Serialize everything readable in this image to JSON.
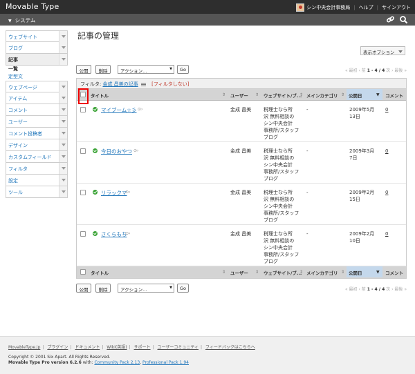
{
  "app": {
    "brand": "Movable Type"
  },
  "header": {
    "site_name": "シン中央会計事務局",
    "help": "ヘルプ",
    "signout": "サインアウト"
  },
  "scope": {
    "name": "システム"
  },
  "sidebar": {
    "items": [
      {
        "label": "ウェブサイト"
      },
      {
        "label": "ブログ"
      },
      {
        "label": "記事"
      },
      {
        "label": "ウェブページ"
      },
      {
        "label": "アイテム"
      },
      {
        "label": "コメント"
      },
      {
        "label": "ユーザー"
      },
      {
        "label": "コメント投稿者"
      },
      {
        "label": "デザイン"
      },
      {
        "label": "カスタムフィールド"
      },
      {
        "label": "フィルタ"
      },
      {
        "label": "設定"
      },
      {
        "label": "ツール"
      }
    ],
    "sub": {
      "list": "一覧",
      "template": "定型文"
    }
  },
  "main": {
    "title": "記事の管理",
    "display_options": "表示オプション"
  },
  "actions": {
    "publish": "公開",
    "delete": "削除",
    "select": "アクション...",
    "go": "Go",
    "pager_prev": "« 最初",
    "pager_prev2": "‹ 前",
    "pager_range": "1 - 4 / 4",
    "pager_next": "次 ›",
    "pager_last": "最後 »"
  },
  "filter": {
    "label": "フィルタ:",
    "value": "金成 昌美の記事",
    "clear": "[フィルタしない]"
  },
  "table": {
    "headers": {
      "title": "タイトル",
      "user": "ユーザー",
      "website": "ウェブサイト/ブ...",
      "category": "メインカテゴリ",
      "date": "公開日",
      "comments": "コメント"
    },
    "rows": [
      {
        "title": "マイブーム☆彡",
        "user": "金成 昌美",
        "blog": "税理士なら所沢 無料相談のシン中央会計事務所/スタッフブログ",
        "blog1": "税理士なら所",
        "blog2": "沢 無料相談の",
        "blog3": "シン中央会計",
        "blog4": "事務所/スタッフ",
        "blog5": "ブログ",
        "category": "-",
        "date1": "2009年5月",
        "date2": "13日",
        "comments": "0"
      },
      {
        "title": "今日のおやつ",
        "user": "金成 昌美",
        "blog1": "税理士なら所",
        "blog2": "沢 無料相談の",
        "blog3": "シン中央会計",
        "blog4": "事務所/スタッフ",
        "blog5": "ブログ",
        "category": "-",
        "date1": "2009年3月",
        "date2": "7日",
        "comments": "0"
      },
      {
        "title": "リラックマ",
        "user": "金成 昌美",
        "blog1": "税理士なら所",
        "blog2": "沢 無料相談の",
        "blog3": "シン中央会計",
        "blog4": "事務所/スタッフ",
        "blog5": "ブログ",
        "category": "-",
        "date1": "2009年2月",
        "date2": "15日",
        "comments": "0"
      },
      {
        "title": "さくらもち",
        "user": "金成 昌美",
        "blog1": "税理士なら所",
        "blog2": "沢 無料相談の",
        "blog3": "シン中央会計",
        "blog4": "事務所/スタッフ",
        "blog5": "ブログ",
        "category": "-",
        "date1": "2009年2月",
        "date2": "10日",
        "comments": "0"
      }
    ]
  },
  "footer": {
    "links": [
      "MovableType.jp",
      "プラグイン",
      "ドキュメント",
      "Wiki(英語)",
      "サポート",
      "ユーザーコミュニティ",
      "フィードバックはこちらへ"
    ],
    "copyright": "Copyright © 2001 Six Apart. All Rights Reserved.",
    "version_prefix": "Movable Type Pro",
    "version_num": "version 6.2.6",
    "version_with": " with: ",
    "pack1": "Community Pack 2.13",
    "pack2": "Professional Pack 1.94"
  },
  "colors": {
    "topbar": "#2e2e2e",
    "scopebar": "#555555",
    "link": "#2277bb",
    "published": "#3aa335",
    "highlight": "#ee0000"
  }
}
